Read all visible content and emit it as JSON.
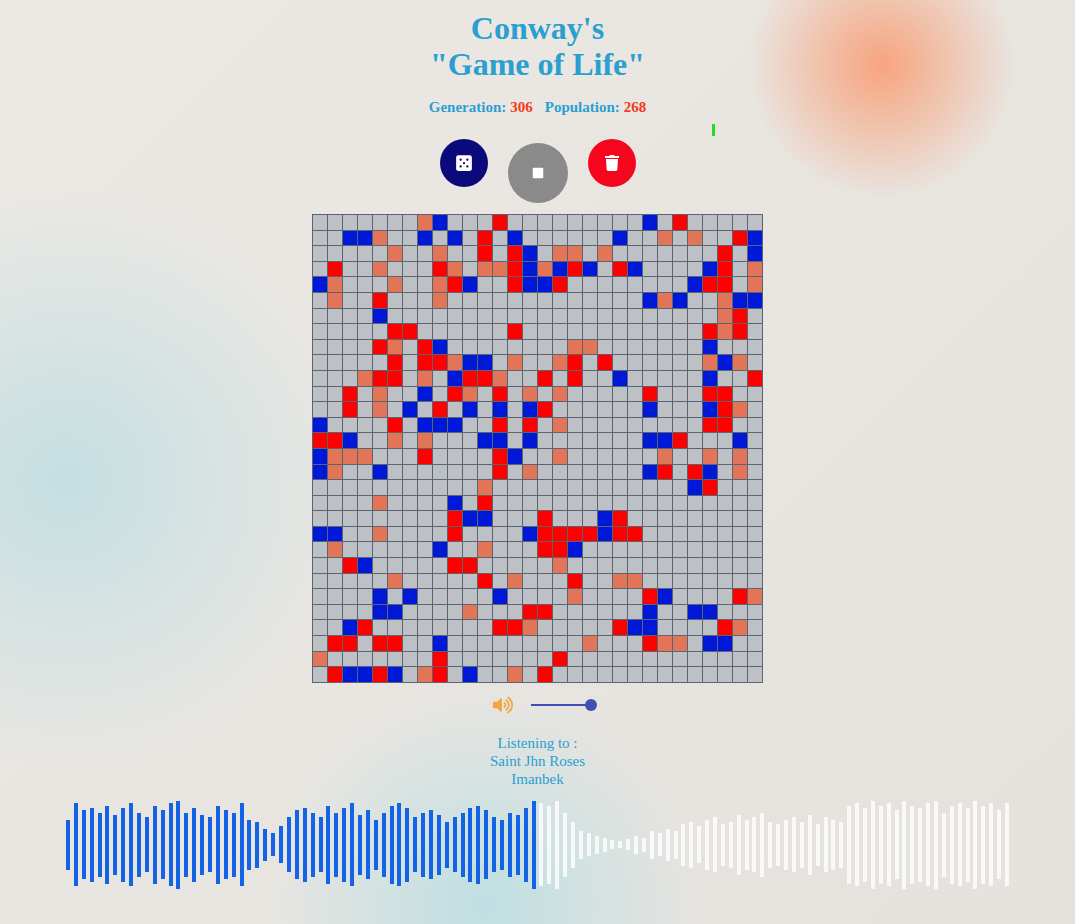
{
  "title": [
    "Conway's",
    "\"Game of Life\""
  ],
  "stats": [
    {
      "label": "Generation:",
      "value": "306"
    },
    {
      "label": "Population:",
      "value": "268"
    }
  ],
  "running": true,
  "controls": [
    {
      "kind": "dice"
    },
    {
      "kind": "stop"
    },
    {
      "kind": "trash"
    }
  ],
  "grid": {
    "rows": [
      {
        "cells": [
          "off",
          "off",
          "off",
          "off",
          "off",
          "off",
          "off",
          "fade",
          "blue",
          "off",
          "off",
          "off",
          "red",
          "off",
          "off",
          "off",
          "off",
          "off",
          "off",
          "off",
          "off",
          "off",
          "blue",
          "off",
          "red",
          "off",
          "off",
          "off",
          "off",
          "off"
        ]
      },
      {
        "cells": [
          "off",
          "off",
          "blue",
          "blue",
          "fade",
          "off",
          "off",
          "blue",
          "off",
          "blue",
          "off",
          "red",
          "off",
          "blue",
          "off",
          "off",
          "off",
          "off",
          "off",
          "off",
          "blue",
          "off",
          "off",
          "fade",
          "off",
          "fade",
          "off",
          "off",
          "red",
          "blue"
        ]
      },
      {
        "cells": [
          "off",
          "off",
          "off",
          "off",
          "off",
          "fade",
          "off",
          "off",
          "fade",
          "off",
          "off",
          "red",
          "off",
          "red",
          "blue",
          "off",
          "fade",
          "fade",
          "off",
          "fade",
          "off",
          "off",
          "off",
          "off",
          "off",
          "off",
          "off",
          "red",
          "off",
          "blue"
        ]
      },
      {
        "cells": [
          "off",
          "red",
          "off",
          "off",
          "fade",
          "off",
          "off",
          "off",
          "red",
          "fade",
          "off",
          "fade",
          "fade",
          "red",
          "blue",
          "fade",
          "blue",
          "red",
          "blue",
          "off",
          "red",
          "blue",
          "off",
          "off",
          "off",
          "off",
          "blue",
          "red",
          "off",
          "fade"
        ]
      },
      {
        "cells": [
          "blue",
          "fade",
          "off",
          "off",
          "off",
          "fade",
          "off",
          "off",
          "fade",
          "red",
          "blue",
          "off",
          "off",
          "red",
          "blue",
          "blue",
          "red",
          "off",
          "off",
          "off",
          "off",
          "off",
          "off",
          "off",
          "off",
          "blue",
          "red",
          "red",
          "off",
          "fade"
        ]
      },
      {
        "cells": [
          "off",
          "fade",
          "off",
          "off",
          "red",
          "off",
          "off",
          "off",
          "fade",
          "off",
          "off",
          "off",
          "off",
          "off",
          "off",
          "off",
          "off",
          "off",
          "off",
          "off",
          "off",
          "off",
          "blue",
          "fade",
          "blue",
          "off",
          "off",
          "fade",
          "blue",
          "blue"
        ]
      },
      {
        "cells": [
          "off",
          "off",
          "off",
          "off",
          "blue",
          "off",
          "off",
          "off",
          "off",
          "off",
          "off",
          "off",
          "off",
          "off",
          "off",
          "off",
          "off",
          "off",
          "off",
          "off",
          "off",
          "off",
          "off",
          "off",
          "off",
          "off",
          "off",
          "fade",
          "red",
          "off"
        ]
      },
      {
        "cells": [
          "off",
          "off",
          "off",
          "off",
          "off",
          "red",
          "red",
          "off",
          "off",
          "off",
          "off",
          "off",
          "off",
          "red",
          "off",
          "off",
          "off",
          "off",
          "off",
          "off",
          "off",
          "off",
          "off",
          "off",
          "off",
          "off",
          "red",
          "fade",
          "red",
          "off"
        ]
      },
      {
        "cells": [
          "off",
          "off",
          "off",
          "off",
          "red",
          "fade",
          "off",
          "red",
          "blue",
          "off",
          "off",
          "off",
          "off",
          "off",
          "off",
          "off",
          "off",
          "fade",
          "fade",
          "off",
          "off",
          "off",
          "off",
          "off",
          "off",
          "off",
          "blue",
          "off",
          "off",
          "off"
        ]
      },
      {
        "cells": [
          "off",
          "off",
          "off",
          "off",
          "off",
          "red",
          "off",
          "red",
          "red",
          "fade",
          "blue",
          "blue",
          "off",
          "fade",
          "off",
          "off",
          "fade",
          "red",
          "off",
          "red",
          "off",
          "off",
          "off",
          "off",
          "off",
          "off",
          "fade",
          "blue",
          "fade",
          "off"
        ]
      },
      {
        "cells": [
          "off",
          "off",
          "off",
          "fade",
          "red",
          "red",
          "off",
          "fade",
          "off",
          "blue",
          "red",
          "red",
          "fade",
          "off",
          "off",
          "red",
          "off",
          "red",
          "off",
          "off",
          "blue",
          "off",
          "off",
          "off",
          "off",
          "off",
          "blue",
          "off",
          "off",
          "red"
        ]
      },
      {
        "cells": [
          "off",
          "off",
          "red",
          "off",
          "fade",
          "off",
          "off",
          "blue",
          "off",
          "red",
          "fade",
          "off",
          "red",
          "off",
          "fade",
          "off",
          "fade",
          "off",
          "off",
          "off",
          "off",
          "off",
          "red",
          "off",
          "off",
          "off",
          "red",
          "red",
          "off",
          "off"
        ]
      },
      {
        "cells": [
          "off",
          "off",
          "red",
          "off",
          "fade",
          "off",
          "blue",
          "off",
          "red",
          "off",
          "blue",
          "off",
          "blue",
          "off",
          "blue",
          "red",
          "off",
          "off",
          "off",
          "off",
          "off",
          "off",
          "blue",
          "off",
          "off",
          "off",
          "blue",
          "red",
          "fade",
          "off"
        ]
      },
      {
        "cells": [
          "blue",
          "off",
          "off",
          "off",
          "off",
          "red",
          "off",
          "blue",
          "blue",
          "blue",
          "off",
          "off",
          "red",
          "off",
          "red",
          "off",
          "fade",
          "off",
          "off",
          "off",
          "off",
          "off",
          "off",
          "off",
          "off",
          "off",
          "red",
          "red",
          "off",
          "off"
        ]
      },
      {
        "cells": [
          "red",
          "red",
          "blue",
          "off",
          "off",
          "fade",
          "off",
          "fade",
          "off",
          "off",
          "off",
          "blue",
          "blue",
          "off",
          "blue",
          "off",
          "off",
          "off",
          "off",
          "off",
          "off",
          "off",
          "blue",
          "blue",
          "red",
          "off",
          "off",
          "off",
          "blue",
          "off"
        ]
      },
      {
        "cells": [
          "blue",
          "fade",
          "fade",
          "fade",
          "off",
          "off",
          "off",
          "red",
          "off",
          "off",
          "off",
          "off",
          "red",
          "blue",
          "off",
          "off",
          "fade",
          "off",
          "off",
          "off",
          "off",
          "off",
          "off",
          "fade",
          "off",
          "off",
          "fade",
          "off",
          "fade",
          "off"
        ]
      },
      {
        "cells": [
          "blue",
          "fade",
          "off",
          "off",
          "blue",
          "off",
          "off",
          "off",
          "off",
          "off",
          "off",
          "off",
          "red",
          "off",
          "fade",
          "off",
          "off",
          "off",
          "off",
          "off",
          "off",
          "off",
          "blue",
          "red",
          "off",
          "red",
          "blue",
          "off",
          "fade",
          "off"
        ]
      },
      {
        "cells": [
          "off",
          "off",
          "off",
          "off",
          "off",
          "off",
          "off",
          "off",
          "off",
          "off",
          "off",
          "fade",
          "off",
          "off",
          "off",
          "off",
          "off",
          "off",
          "off",
          "off",
          "off",
          "off",
          "off",
          "off",
          "off",
          "blue",
          "red",
          "off",
          "off",
          "off"
        ]
      },
      {
        "cells": [
          "off",
          "off",
          "off",
          "off",
          "fade",
          "off",
          "off",
          "off",
          "off",
          "blue",
          "off",
          "red",
          "off",
          "off",
          "off",
          "off",
          "off",
          "off",
          "off",
          "off",
          "off",
          "off",
          "off",
          "off",
          "off",
          "off",
          "off",
          "off",
          "off",
          "off"
        ]
      },
      {
        "cells": [
          "off",
          "off",
          "off",
          "off",
          "off",
          "off",
          "off",
          "off",
          "off",
          "red",
          "blue",
          "blue",
          "off",
          "off",
          "off",
          "red",
          "off",
          "off",
          "off",
          "blue",
          "red",
          "off",
          "off",
          "off",
          "off",
          "off",
          "off",
          "off",
          "off",
          "off"
        ]
      },
      {
        "cells": [
          "blue",
          "blue",
          "off",
          "off",
          "fade",
          "off",
          "off",
          "off",
          "off",
          "red",
          "off",
          "off",
          "off",
          "off",
          "blue",
          "red",
          "red",
          "red",
          "red",
          "blue",
          "red",
          "red",
          "off",
          "off",
          "off",
          "off",
          "off",
          "off",
          "off",
          "off"
        ]
      },
      {
        "cells": [
          "off",
          "fade",
          "off",
          "off",
          "off",
          "off",
          "off",
          "off",
          "blue",
          "off",
          "off",
          "fade",
          "off",
          "off",
          "off",
          "red",
          "red",
          "blue",
          "off",
          "off",
          "off",
          "off",
          "off",
          "off",
          "off",
          "off",
          "off",
          "off",
          "off",
          "off"
        ]
      },
      {
        "cells": [
          "off",
          "off",
          "red",
          "blue",
          "off",
          "off",
          "off",
          "off",
          "off",
          "red",
          "red",
          "off",
          "off",
          "off",
          "off",
          "off",
          "fade",
          "off",
          "off",
          "off",
          "off",
          "off",
          "off",
          "off",
          "off",
          "off",
          "off",
          "off",
          "off",
          "off"
        ]
      },
      {
        "cells": [
          "off",
          "off",
          "off",
          "off",
          "off",
          "fade",
          "off",
          "off",
          "off",
          "off",
          "off",
          "red",
          "off",
          "fade",
          "off",
          "off",
          "off",
          "red",
          "off",
          "off",
          "fade",
          "fade",
          "off",
          "off",
          "off",
          "off",
          "off",
          "off",
          "off",
          "off"
        ]
      },
      {
        "cells": [
          "off",
          "off",
          "off",
          "off",
          "blue",
          "off",
          "blue",
          "off",
          "off",
          "off",
          "off",
          "off",
          "blue",
          "off",
          "off",
          "off",
          "off",
          "fade",
          "off",
          "off",
          "off",
          "off",
          "red",
          "blue",
          "off",
          "off",
          "off",
          "off",
          "red",
          "fade"
        ]
      },
      {
        "cells": [
          "off",
          "off",
          "off",
          "off",
          "blue",
          "blue",
          "off",
          "off",
          "off",
          "off",
          "fade",
          "off",
          "off",
          "off",
          "red",
          "red",
          "off",
          "off",
          "off",
          "off",
          "off",
          "off",
          "blue",
          "off",
          "off",
          "blue",
          "blue",
          "off",
          "off",
          "off"
        ]
      },
      {
        "cells": [
          "off",
          "off",
          "blue",
          "red",
          "off",
          "off",
          "off",
          "off",
          "off",
          "off",
          "off",
          "off",
          "red",
          "red",
          "fade",
          "off",
          "off",
          "off",
          "off",
          "off",
          "red",
          "blue",
          "blue",
          "off",
          "off",
          "off",
          "off",
          "red",
          "fade",
          "off"
        ]
      },
      {
        "cells": [
          "off",
          "red",
          "red",
          "off",
          "red",
          "red",
          "off",
          "off",
          "blue",
          "off",
          "off",
          "off",
          "off",
          "off",
          "off",
          "off",
          "off",
          "off",
          "fade",
          "off",
          "off",
          "off",
          "red",
          "fade",
          "fade",
          "off",
          "blue",
          "blue",
          "off",
          "off"
        ]
      },
      {
        "cells": [
          "fade",
          "off",
          "off",
          "off",
          "off",
          "off",
          "off",
          "off",
          "red",
          "off",
          "off",
          "off",
          "off",
          "off",
          "off",
          "off",
          "red",
          "off",
          "off",
          "off",
          "off",
          "off",
          "off",
          "off",
          "off",
          "off",
          "off",
          "off",
          "off",
          "off"
        ]
      },
      {
        "cells": [
          "off",
          "red",
          "blue",
          "blue",
          "red",
          "blue",
          "off",
          "fade",
          "red",
          "off",
          "blue",
          "off",
          "off",
          "fade",
          "off",
          "red",
          "off",
          "off",
          "off",
          "off",
          "off",
          "off",
          "off",
          "off",
          "off",
          "off",
          "off",
          "off",
          "off",
          "off"
        ]
      }
    ]
  },
  "volume": {
    "level": 1.0
  },
  "now_playing": {
    "label": "Listening to :",
    "title": "Saint Jhn Roses",
    "artist": "Imanbek"
  },
  "waveform": {
    "level": 0.5,
    "values": [
      0.55,
      0.9,
      0.75,
      0.8,
      0.7,
      0.85,
      0.65,
      0.8,
      0.9,
      0.7,
      0.6,
      0.85,
      0.75,
      0.9,
      0.95,
      0.7,
      0.8,
      0.65,
      0.6,
      0.85,
      0.75,
      0.7,
      0.9,
      0.55,
      0.5,
      0.35,
      0.25,
      0.4,
      0.6,
      0.75,
      0.8,
      0.7,
      0.6,
      0.85,
      0.7,
      0.8,
      0.9,
      0.65,
      0.75,
      0.55,
      0.7,
      0.85,
      0.9,
      0.8,
      0.6,
      0.7,
      0.75,
      0.65,
      0.5,
      0.6,
      0.7,
      0.8,
      0.85,
      0.75,
      0.6,
      0.55,
      0.7,
      0.65,
      0.8,
      0.95,
      0.9,
      0.85,
      0.95,
      0.7,
      0.5,
      0.3,
      0.25,
      0.2,
      0.15,
      0.1,
      0.08,
      0.12,
      0.2,
      0.15,
      0.3,
      0.25,
      0.35,
      0.3,
      0.45,
      0.5,
      0.4,
      0.55,
      0.6,
      0.45,
      0.5,
      0.65,
      0.55,
      0.6,
      0.7,
      0.5,
      0.45,
      0.55,
      0.6,
      0.5,
      0.65,
      0.45,
      0.6,
      0.55,
      0.5,
      0.85,
      0.9,
      0.8,
      0.95,
      0.85,
      0.9,
      0.75,
      0.95,
      0.85,
      0.8,
      0.9,
      0.95,
      0.7,
      0.85,
      0.9,
      0.8,
      0.95,
      0.85,
      0.9,
      0.75,
      0.9
    ]
  }
}
